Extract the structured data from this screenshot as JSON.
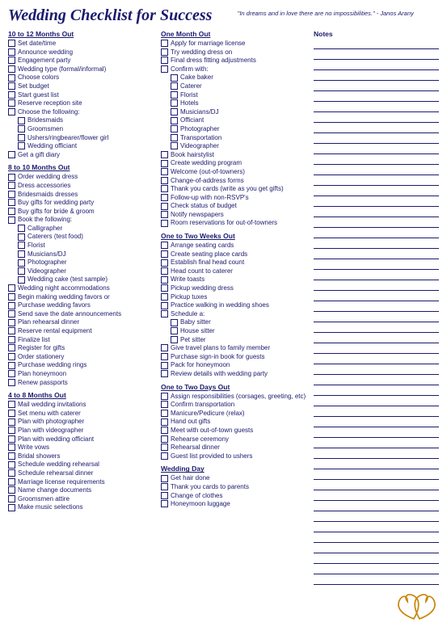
{
  "header": {
    "title": "Wedding Checklist for Success",
    "quote": "\"In dreams and in love there are no impossibilities.\" - Janos Arany"
  },
  "sections": {
    "ten_to_twelve": {
      "title": "10 to 12 Months Out",
      "items": [
        "Set date/time",
        "Announce wedding",
        "Engagement party",
        "Wedding type (formal/informal)",
        "Choose colors",
        "Set budget",
        "Start guest list",
        "Reserve reception site",
        "Choose the following:",
        "Bridesmaids",
        "Groomsmen",
        "Ushers/ringbearer/flower girl",
        "Wedding officiant",
        "Get a gift diary"
      ],
      "sub_items": [
        "Bridesmaids",
        "Groomsmen",
        "Ushers/ringbearer/flower girl",
        "Wedding officiant"
      ]
    },
    "eight_to_ten": {
      "title": "8 to 10 Months Out",
      "items": [
        "Order wedding dress",
        "Dress accessories",
        "Bridesmaids dresses",
        "Buy gifts for wedding party",
        "Buy gifts for bride & groom",
        "Book the following:",
        "Calligrapher",
        "Caterers (test food)",
        "Florist",
        "Musicians/DJ",
        "Photographer",
        "Videographer",
        "Wedding cake (test sample)",
        "Wedding night accommodations",
        "Begin making wedding favors or",
        "Purchase wedding favors",
        "Send save the date announcements",
        "Plan rehearsal dinner",
        "Reserve rental equipment",
        "Finalize list",
        "Register for gifts",
        "Order stationery",
        "Purchase wedding rings",
        "Plan honeymoon",
        "Renew passports"
      ],
      "sub_items": [
        "Calligrapher",
        "Caterers (test food)",
        "Florist",
        "Musicians/DJ",
        "Photographer",
        "Videographer",
        "Wedding cake (test sample)"
      ]
    },
    "four_to_eight": {
      "title": "4 to 8 Months Out",
      "items": [
        "Mail wedding invitations",
        "Set menu with caterer",
        "Plan with photographer",
        "Plan with videographer",
        "Plan with wedding officiant",
        "Write vows",
        "Bridal showers",
        "Schedule wedding rehearsal",
        "Schedule rehearsal dinner",
        "Marriage license requirements",
        "Name change documents",
        "Groomsmen attire",
        "Make music selections"
      ]
    },
    "one_month": {
      "title": "One Month Out",
      "items": [
        "Apply for marriage license",
        "Try wedding dress on",
        "Final dress fitting adjustments",
        "Confirm with:",
        "Cake baker",
        "Caterer",
        "Florist",
        "Hotels",
        "Musicians/DJ",
        "Officiant",
        "Photographer",
        "Transportation",
        "Videographer",
        "Book hairstylist",
        "Create wedding program",
        "Welcome (out-of-towners)",
        "Change-of-address forms",
        "Thank you cards (write as you get gifts)",
        "Follow-up with non-RSVP's",
        "Check status of budget",
        "Notify newspapers",
        "Room reservations for out-of-towners"
      ],
      "sub_items": [
        "Cake baker",
        "Caterer",
        "Florist",
        "Hotels",
        "Musicians/DJ",
        "Officiant",
        "Photographer",
        "Transportation",
        "Videographer"
      ]
    },
    "one_to_two_weeks": {
      "title": "One to Two Weeks Out",
      "items": [
        "Arrange seating cards",
        "Create seating place cards",
        "Establish final head count",
        "Head count to caterer",
        "Write toasts",
        "Pickup wedding dress",
        "Pickup tuxes",
        "Practice walking in wedding shoes",
        "Schedule a:",
        "Baby sitter",
        "House sitter",
        "Pet sitter",
        "Give travel plans to family member",
        "Purchase sign-in book for guests",
        "Pack for honeymoon",
        "Review details with wedding party"
      ],
      "sub_items": [
        "Baby sitter",
        "House sitter",
        "Pet sitter"
      ]
    },
    "one_to_two_days": {
      "title": "One to Two Days Out",
      "items": [
        "Assign responsibilities (corsages, greeting, etc)",
        "Confirm transportation",
        "Manicure/Pedicure (relax)",
        "Hand out gifts",
        "Meet with out-of-town guests",
        "Rehearse ceremony",
        "Rehearsal dinner",
        "Guest list provided to ushers"
      ]
    },
    "wedding_day": {
      "title": "Wedding Day",
      "items": [
        "Get hair done",
        "Thank you cards to parents",
        "Change of clothes",
        "Honeymoon luggage"
      ]
    }
  },
  "notes": {
    "title": "Notes",
    "line_count": 55
  }
}
